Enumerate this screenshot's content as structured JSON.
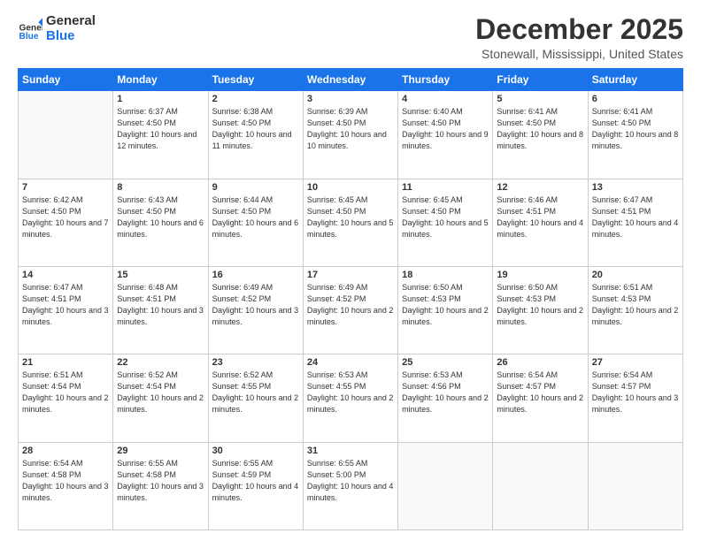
{
  "logo": {
    "line1": "General",
    "line2": "Blue"
  },
  "title": "December 2025",
  "location": "Stonewall, Mississippi, United States",
  "weekdays": [
    "Sunday",
    "Monday",
    "Tuesday",
    "Wednesday",
    "Thursday",
    "Friday",
    "Saturday"
  ],
  "weeks": [
    [
      {
        "day": null
      },
      {
        "day": "1",
        "sunrise": "6:37 AM",
        "sunset": "4:50 PM",
        "daylight": "10 hours and 12 minutes."
      },
      {
        "day": "2",
        "sunrise": "6:38 AM",
        "sunset": "4:50 PM",
        "daylight": "10 hours and 11 minutes."
      },
      {
        "day": "3",
        "sunrise": "6:39 AM",
        "sunset": "4:50 PM",
        "daylight": "10 hours and 10 minutes."
      },
      {
        "day": "4",
        "sunrise": "6:40 AM",
        "sunset": "4:50 PM",
        "daylight": "10 hours and 9 minutes."
      },
      {
        "day": "5",
        "sunrise": "6:41 AM",
        "sunset": "4:50 PM",
        "daylight": "10 hours and 8 minutes."
      },
      {
        "day": "6",
        "sunrise": "6:41 AM",
        "sunset": "4:50 PM",
        "daylight": "10 hours and 8 minutes."
      }
    ],
    [
      {
        "day": "7",
        "sunrise": "6:42 AM",
        "sunset": "4:50 PM",
        "daylight": "10 hours and 7 minutes."
      },
      {
        "day": "8",
        "sunrise": "6:43 AM",
        "sunset": "4:50 PM",
        "daylight": "10 hours and 6 minutes."
      },
      {
        "day": "9",
        "sunrise": "6:44 AM",
        "sunset": "4:50 PM",
        "daylight": "10 hours and 6 minutes."
      },
      {
        "day": "10",
        "sunrise": "6:45 AM",
        "sunset": "4:50 PM",
        "daylight": "10 hours and 5 minutes."
      },
      {
        "day": "11",
        "sunrise": "6:45 AM",
        "sunset": "4:50 PM",
        "daylight": "10 hours and 5 minutes."
      },
      {
        "day": "12",
        "sunrise": "6:46 AM",
        "sunset": "4:51 PM",
        "daylight": "10 hours and 4 minutes."
      },
      {
        "day": "13",
        "sunrise": "6:47 AM",
        "sunset": "4:51 PM",
        "daylight": "10 hours and 4 minutes."
      }
    ],
    [
      {
        "day": "14",
        "sunrise": "6:47 AM",
        "sunset": "4:51 PM",
        "daylight": "10 hours and 3 minutes."
      },
      {
        "day": "15",
        "sunrise": "6:48 AM",
        "sunset": "4:51 PM",
        "daylight": "10 hours and 3 minutes."
      },
      {
        "day": "16",
        "sunrise": "6:49 AM",
        "sunset": "4:52 PM",
        "daylight": "10 hours and 3 minutes."
      },
      {
        "day": "17",
        "sunrise": "6:49 AM",
        "sunset": "4:52 PM",
        "daylight": "10 hours and 2 minutes."
      },
      {
        "day": "18",
        "sunrise": "6:50 AM",
        "sunset": "4:53 PM",
        "daylight": "10 hours and 2 minutes."
      },
      {
        "day": "19",
        "sunrise": "6:50 AM",
        "sunset": "4:53 PM",
        "daylight": "10 hours and 2 minutes."
      },
      {
        "day": "20",
        "sunrise": "6:51 AM",
        "sunset": "4:53 PM",
        "daylight": "10 hours and 2 minutes."
      }
    ],
    [
      {
        "day": "21",
        "sunrise": "6:51 AM",
        "sunset": "4:54 PM",
        "daylight": "10 hours and 2 minutes."
      },
      {
        "day": "22",
        "sunrise": "6:52 AM",
        "sunset": "4:54 PM",
        "daylight": "10 hours and 2 minutes."
      },
      {
        "day": "23",
        "sunrise": "6:52 AM",
        "sunset": "4:55 PM",
        "daylight": "10 hours and 2 minutes."
      },
      {
        "day": "24",
        "sunrise": "6:53 AM",
        "sunset": "4:55 PM",
        "daylight": "10 hours and 2 minutes."
      },
      {
        "day": "25",
        "sunrise": "6:53 AM",
        "sunset": "4:56 PM",
        "daylight": "10 hours and 2 minutes."
      },
      {
        "day": "26",
        "sunrise": "6:54 AM",
        "sunset": "4:57 PM",
        "daylight": "10 hours and 2 minutes."
      },
      {
        "day": "27",
        "sunrise": "6:54 AM",
        "sunset": "4:57 PM",
        "daylight": "10 hours and 3 minutes."
      }
    ],
    [
      {
        "day": "28",
        "sunrise": "6:54 AM",
        "sunset": "4:58 PM",
        "daylight": "10 hours and 3 minutes."
      },
      {
        "day": "29",
        "sunrise": "6:55 AM",
        "sunset": "4:58 PM",
        "daylight": "10 hours and 3 minutes."
      },
      {
        "day": "30",
        "sunrise": "6:55 AM",
        "sunset": "4:59 PM",
        "daylight": "10 hours and 4 minutes."
      },
      {
        "day": "31",
        "sunrise": "6:55 AM",
        "sunset": "5:00 PM",
        "daylight": "10 hours and 4 minutes."
      },
      {
        "day": null
      },
      {
        "day": null
      },
      {
        "day": null
      }
    ]
  ]
}
